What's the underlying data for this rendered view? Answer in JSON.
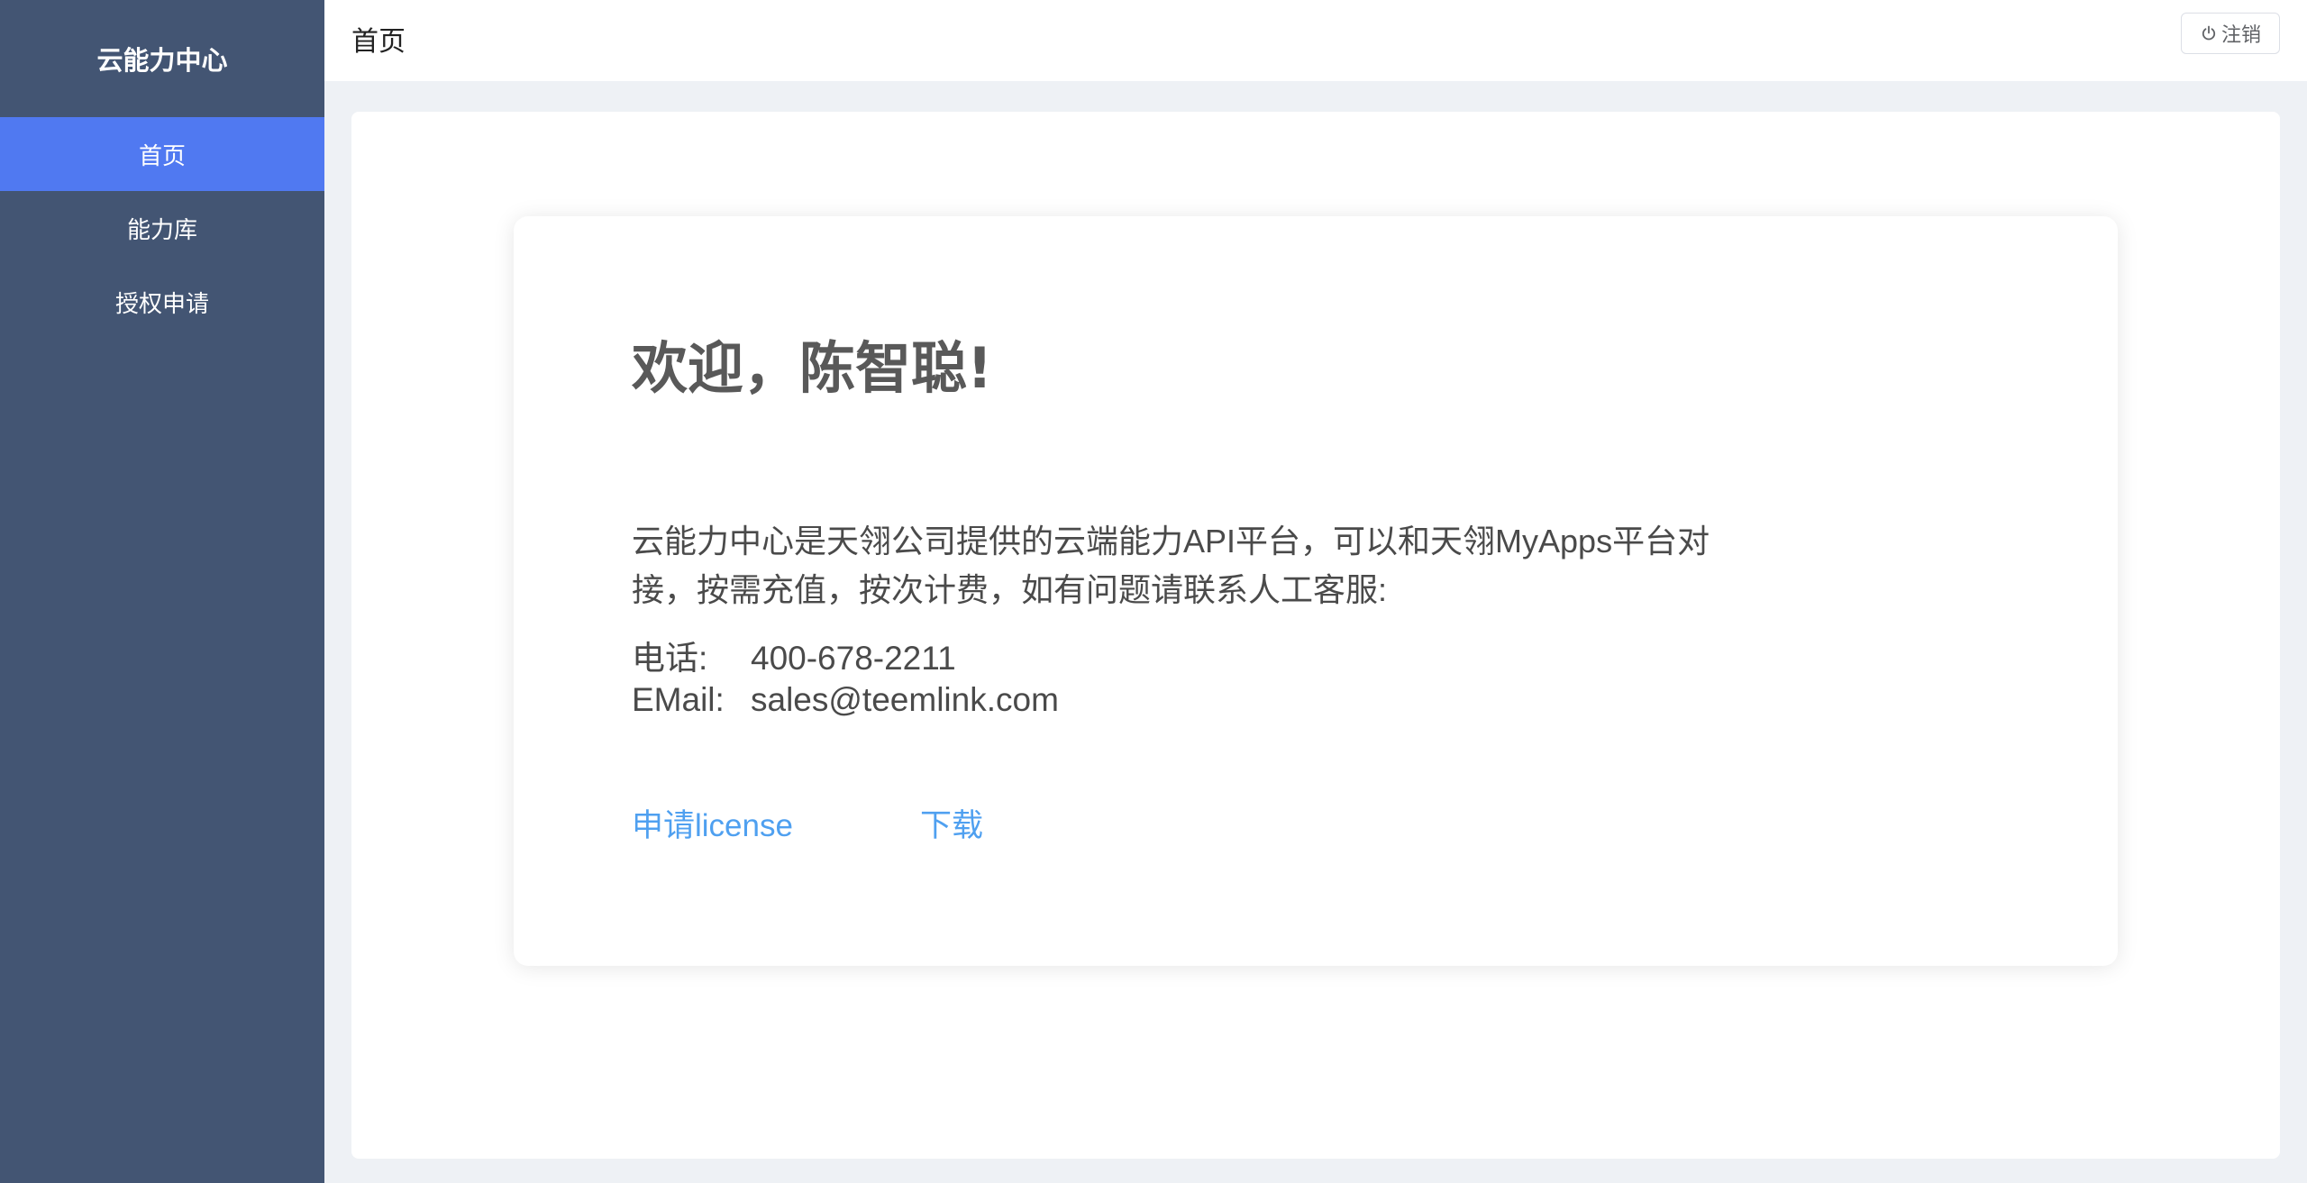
{
  "sidebar": {
    "brand": "云能力中心",
    "items": [
      {
        "label": "首页",
        "active": true
      },
      {
        "label": "能力库",
        "active": false
      },
      {
        "label": "授权申请",
        "active": false
      }
    ]
  },
  "header": {
    "title": "首页",
    "logout_label": "注销",
    "logout_icon": "power-icon"
  },
  "welcome": {
    "greeting": "欢迎，陈智聪!",
    "intro": "云能力中心是天翎公司提供的云端能力API平台，可以和天翎MyApps平台对接，按需充值，按次计费，如有问题请联系人工客服:",
    "phone_label": "电话:",
    "phone": "400-678-2211",
    "email_label": "EMail:",
    "email": "sales@teemlink.com",
    "apply_license_label": "申请license",
    "download_label": "下载"
  },
  "colors": {
    "sidebar_bg": "#435573",
    "sidebar_active": "#5079f1",
    "link": "#4fa0f0",
    "page_bg": "#eef1f5"
  }
}
